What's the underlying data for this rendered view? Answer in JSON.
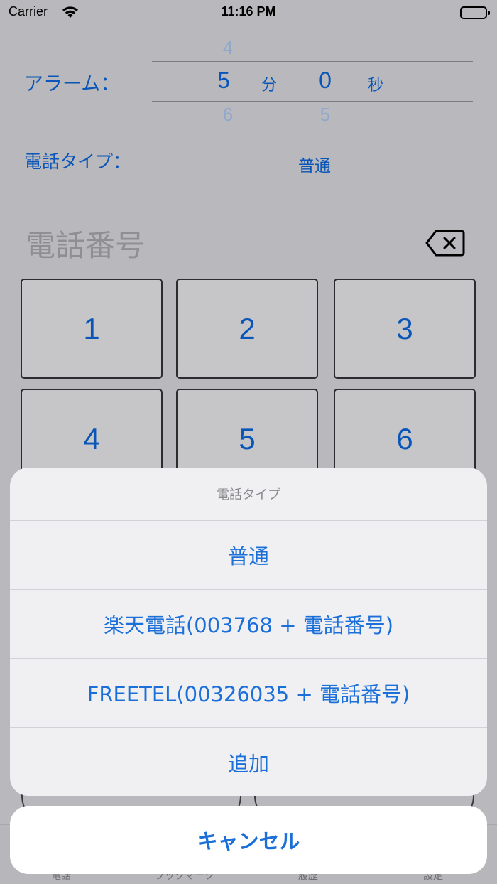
{
  "status_bar": {
    "carrier": "Carrier",
    "time": "11:16 PM"
  },
  "alarm": {
    "label": "アラーム：",
    "minutes": {
      "above": "4",
      "selected": "5",
      "below": "6",
      "unit": "分"
    },
    "seconds": {
      "selected": "0",
      "below": "5",
      "unit": "秒"
    }
  },
  "phone_type": {
    "label": "電話タイプ：",
    "value": "普通"
  },
  "phone_number": {
    "placeholder": "電話番号"
  },
  "keypad": {
    "keys": [
      "1",
      "2",
      "3",
      "4",
      "5",
      "6"
    ]
  },
  "tabbar": {
    "tabs": [
      "電話",
      "ブックマーク",
      "履歴",
      "設定"
    ]
  },
  "action_sheet": {
    "title": "電話タイプ",
    "options": [
      "普通",
      "楽天電話(003768 + 電話番号)",
      "FREETEL(00326035 + 電話番号)",
      "追加"
    ],
    "cancel": "キャンセル"
  },
  "colors": {
    "accent": "#1b6fd9",
    "label_blue": "#0a56b8",
    "dim_overlay": "#b9b9bd"
  }
}
